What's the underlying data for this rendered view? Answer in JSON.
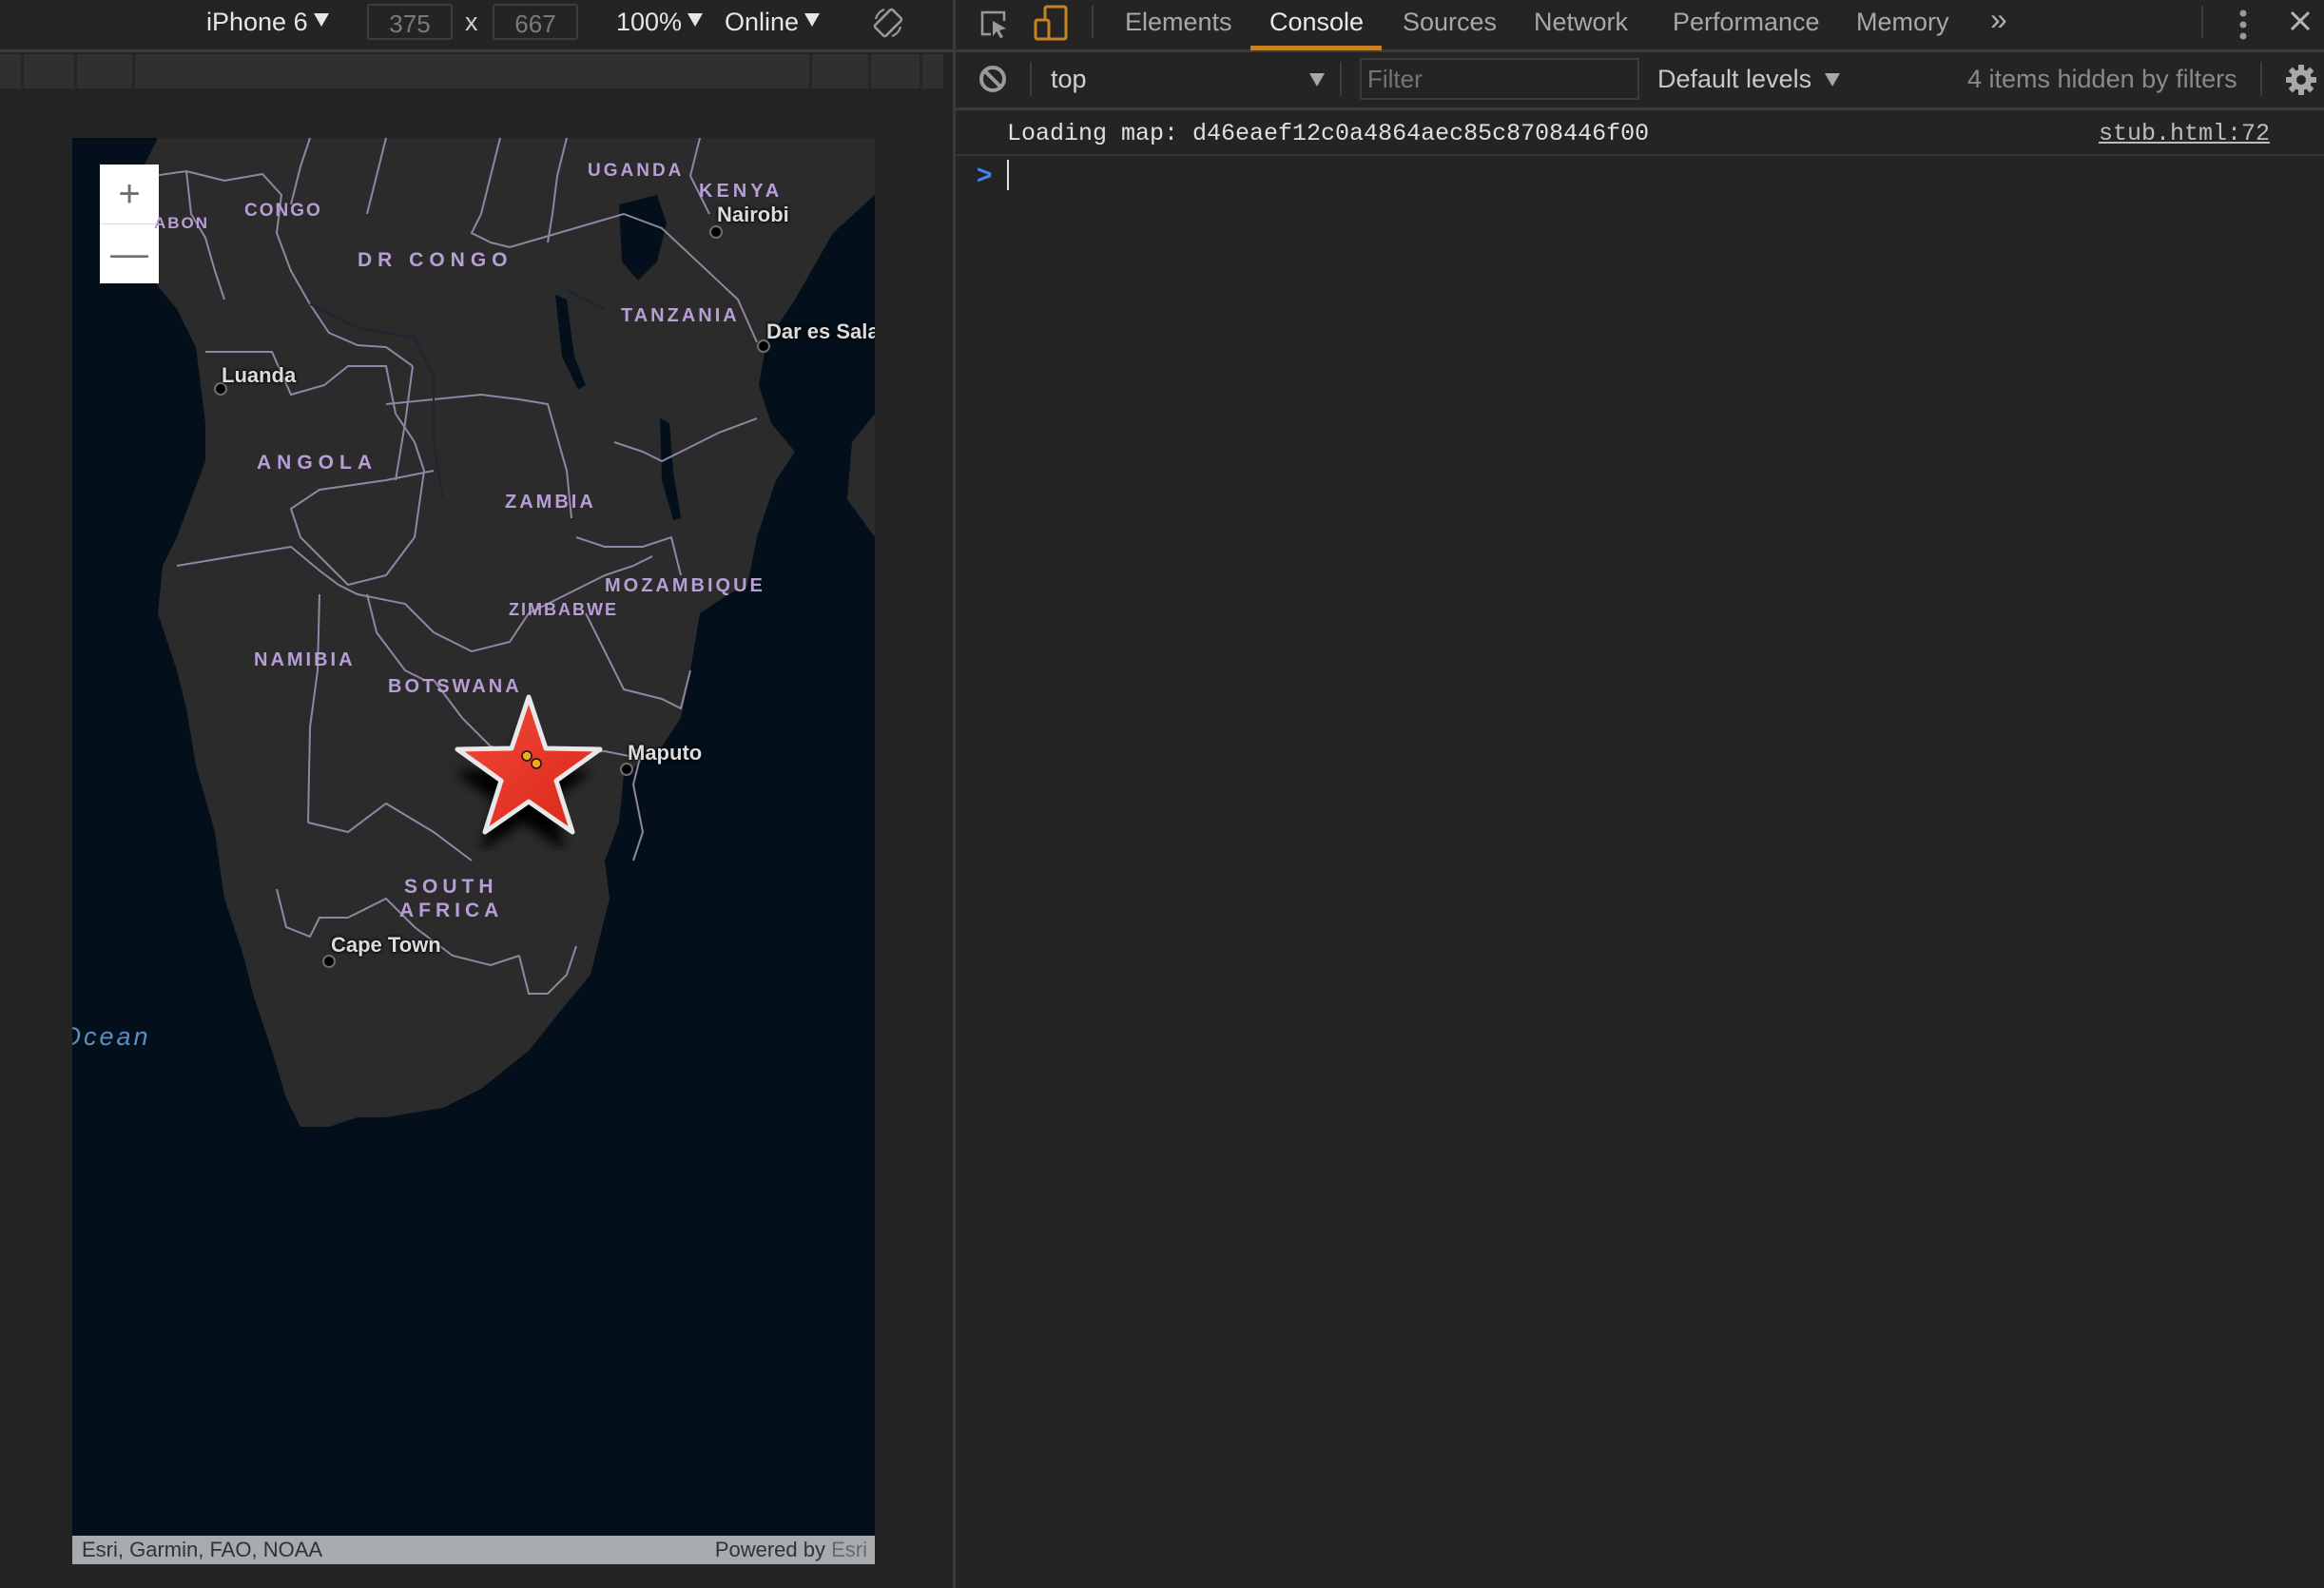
{
  "device_toolbar": {
    "device": "iPhone 6",
    "width": "375",
    "height": "667",
    "dimension_separator": "x",
    "zoom": "100%",
    "network": "Online",
    "rotate_icon": "rotate-icon"
  },
  "map": {
    "zoom_in": "+",
    "zoom_out": "—",
    "countries": [
      "GABON",
      "CONGO",
      "DR CONGO",
      "UGANDA",
      "KENYA",
      "TANZANIA",
      "ANGOLA",
      "ZAMBIA",
      "MOZAMBIQUE",
      "ZIMBABWE",
      "NAMIBIA",
      "BOTSWANA",
      "SOUTH AFRICA"
    ],
    "labels": {
      "gabon": "ABON",
      "congo": "CONGO",
      "dr_congo": "DR CONGO",
      "uganda": "UGANDA",
      "kenya": "KENYA",
      "tanzania": "TANZANIA",
      "angola": "ANGOLA",
      "zambia": "ZAMBIA",
      "mozambique": "MOZAMBIQUE",
      "zimbabwe": "ZIMBABWE",
      "namibia": "NAMIBIA",
      "botswana": "BOTSWANA",
      "south": "SOUTH",
      "africa": "AFRICA"
    },
    "cities": {
      "nairobi": "Nairobi",
      "dar_es_salaam": "Dar es Sala",
      "luanda": "Luanda",
      "maputo": "Maputo",
      "cape_town": "Cape Town"
    },
    "ocean": "Ocean",
    "marker": "star-marker",
    "attribution_left": "Esri, Garmin, FAO, NOAA",
    "attribution_powered": "Powered by ",
    "attribution_esri": "Esri"
  },
  "devtools": {
    "tabs": [
      "Elements",
      "Console",
      "Sources",
      "Network",
      "Performance",
      "Memory"
    ],
    "active_tab": "Console",
    "more_tabs": "»",
    "console_toolbar": {
      "context": "top",
      "filter_placeholder": "Filter",
      "levels": "Default levels",
      "hidden_info": "4 items hidden by filters"
    },
    "log": {
      "message": "Loading map: d46eaef12c0a4864aec85c8708446f00",
      "source": "stub.html:72"
    },
    "prompt": ">"
  },
  "colors": {
    "accent": "#c78221",
    "prompt": "#3f86f2",
    "map_water": "#03101c",
    "map_land": "#2b2b2b",
    "country_label": "#b79ed6",
    "marker": "#ee3322"
  }
}
